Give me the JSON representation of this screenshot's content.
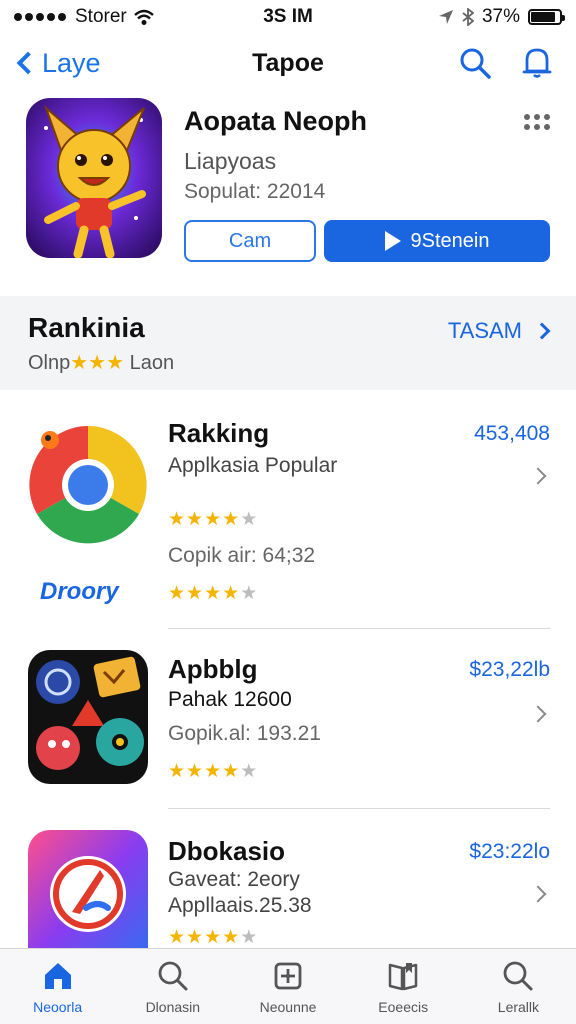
{
  "status_bar": {
    "carrier": "Storer",
    "time": "3S IM",
    "battery": "37%",
    "battery_level": 0.85
  },
  "nav": {
    "back_label": "Laye",
    "title": "Tapoe",
    "icons": [
      "search-icon",
      "bell-icon"
    ]
  },
  "featured": {
    "name": "Aopata Neoph",
    "subtitle": "Liapyoas",
    "meta": "Sopulat: 22014",
    "button_outline": "Cam",
    "button_primary": "9Stenein"
  },
  "ranking": {
    "title": "Rankinia",
    "sub_prefix": "Olnp",
    "sub_stars": "★★★",
    "sub_suffix": "Laon",
    "link": "TASAM"
  },
  "apps": [
    {
      "name": "Rakking",
      "price": "453,408",
      "line1": "Applkasia Popular",
      "line2": "Copik air: 64;32",
      "rating": 4,
      "brand": "Droory",
      "icon": "chrome-like-icon"
    },
    {
      "name": "Apbblg",
      "price": "$23,22lb",
      "line1": "Pahak 12600",
      "line2": "Gopik.al: 193.21",
      "rating": 4,
      "icon": "game-shapes-icon"
    },
    {
      "name": "Dbokasio",
      "price": "$23:22lo",
      "line1": "Gaveat: 2eory",
      "line2": "Appllaais.25.38",
      "rating": 4,
      "icon": "music-logo-icon"
    }
  ],
  "tabs": [
    {
      "label": "Neoorla",
      "icon": "home-icon",
      "active": true
    },
    {
      "label": "Dlonasin",
      "icon": "search-icon",
      "active": false
    },
    {
      "label": "Neounne",
      "icon": "add-box-icon",
      "active": false
    },
    {
      "label": "Eoeecis",
      "icon": "book-icon",
      "active": false
    },
    {
      "label": "Lerallk",
      "icon": "search-icon",
      "active": false
    }
  ],
  "colors": {
    "accent": "#1a66e0",
    "star": "#f5b400",
    "section_bg": "#f3f4f6"
  }
}
